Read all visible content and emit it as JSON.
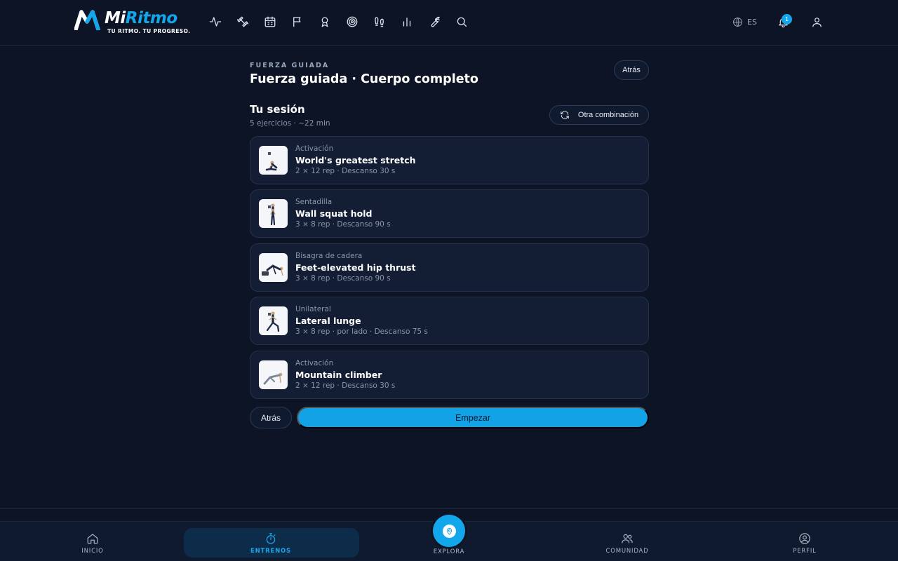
{
  "brand": {
    "name_part1": "Mi",
    "name_part2": "Ritmo",
    "tagline": "TU RITMO. TU PROGRESO.",
    "accent_color": "#12a6ea"
  },
  "header": {
    "nav_icons": [
      "activity-icon",
      "dumbbell-icon",
      "calendar-icon",
      "flag-icon",
      "medal-icon",
      "target-icon",
      "footprints-icon",
      "bar-chart-icon",
      "wrench-icon",
      "search-icon"
    ],
    "language": "ES",
    "notifications_count": "1"
  },
  "page": {
    "kicker": "FUERZA GUIADA",
    "title": "Fuerza guiada · Cuerpo completo",
    "back_label": "Atrás"
  },
  "session": {
    "title": "Tu sesión",
    "subtitle": "5 ejercicios · ~22 min",
    "reshuffle_label": "Otra combinación"
  },
  "exercises": [
    {
      "category": "Activación",
      "name": "World's greatest stretch",
      "meta": "2 × 12 rep · Descanso 30 s",
      "thumb": "stretch-figure"
    },
    {
      "category": "Sentadilla",
      "name": "Wall squat hold",
      "meta": "3 × 8 rep · Descanso 90 s",
      "thumb": "standing-figure"
    },
    {
      "category": "Bisagra de cadera",
      "name": "Feet-elevated hip thrust",
      "meta": "3 × 8 rep · Descanso 90 s",
      "thumb": "bridge-figure"
    },
    {
      "category": "Unilateral",
      "name": "Lateral lunge",
      "meta": "3 × 8 rep · por lado · Descanso 75 s",
      "thumb": "lunge-figure"
    },
    {
      "category": "Activación",
      "name": "Mountain climber",
      "meta": "2 × 12 rep · Descanso 30 s",
      "thumb": "plank-figure"
    }
  ],
  "actions": {
    "back_label": "Atrás",
    "start_label": "Empezar"
  },
  "bottom_nav": {
    "items": [
      {
        "label": "INICIO",
        "icon": "home-icon"
      },
      {
        "label": "ENTRENOS",
        "icon": "stopwatch-icon",
        "active": true
      },
      {
        "label": "EXPLORA",
        "icon": "map-pin-icon"
      },
      {
        "label": "COMUNIDAD",
        "icon": "users-icon"
      },
      {
        "label": "PERFIL",
        "icon": "user-circle-icon"
      }
    ]
  }
}
